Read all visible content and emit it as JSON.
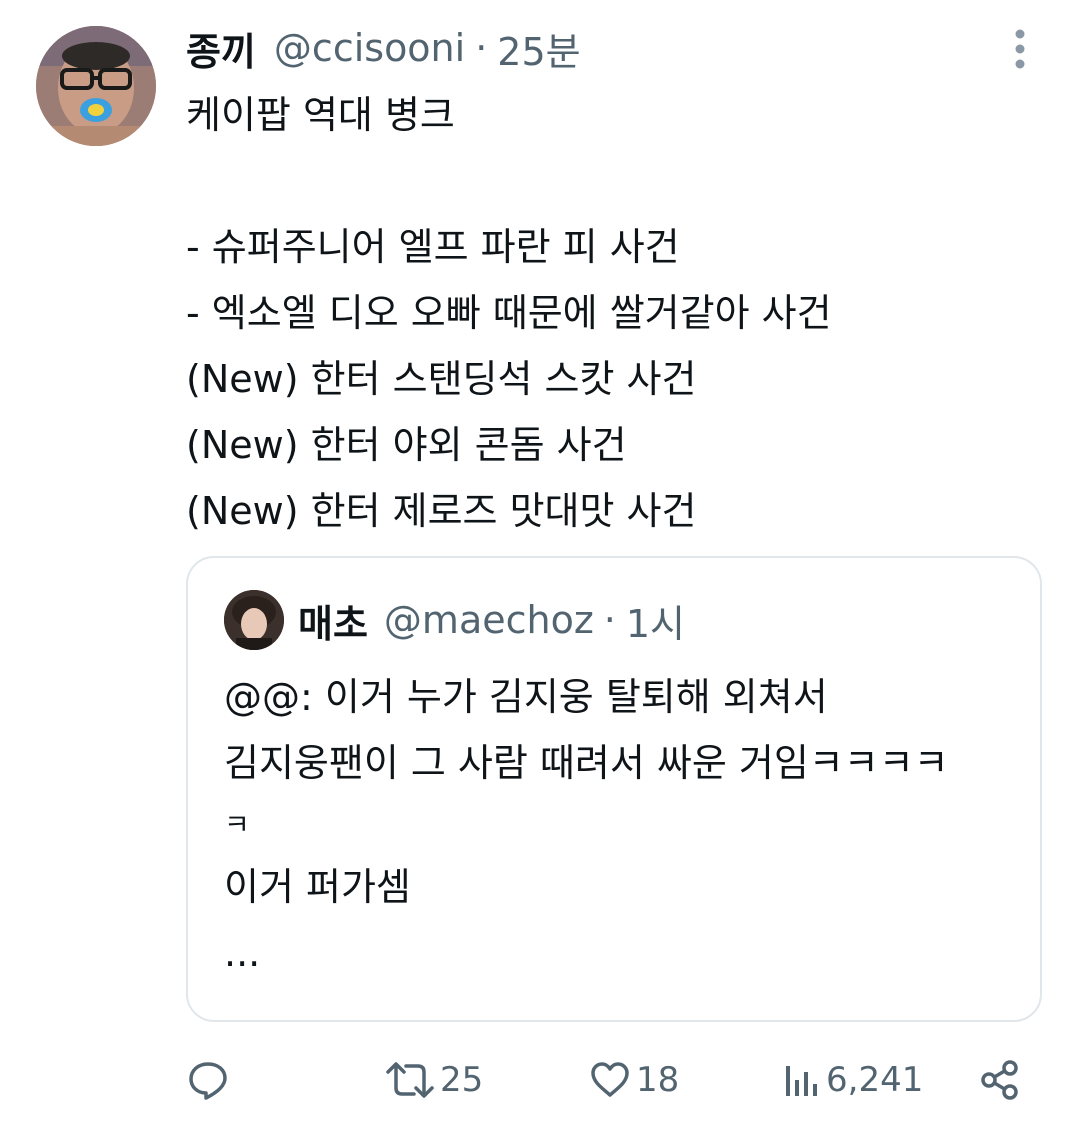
{
  "tweet": {
    "author_name": "종끼",
    "author_handle": "@ccisooni",
    "separator": "·",
    "time": "25분",
    "lines": [
      "케이팝 역대 병크",
      "",
      "- 슈퍼주니어 엘프 파란 피 사건",
      "- 엑소엘 디오 오빠 때문에 쌀거같아 사건",
      "(New) 한터 스탠딩석 스캇 사건",
      "(New) 한터 야외 콘돔 사건",
      "(New) 한터 제로즈 맛대맛 사건"
    ]
  },
  "quote": {
    "author_name": "매초",
    "author_handle": "@maechoz",
    "separator": "·",
    "time": "1시",
    "lines": [
      "@@: 이거 누가 김지웅 탈퇴해 외쳐서",
      "김지웅팬이 그 사람 때려서 싸운 거임ㅋㅋㅋㅋ",
      "ㅋ",
      "이거 퍼가셈",
      "..."
    ]
  },
  "actions": {
    "reply": {
      "icon": "reply-icon",
      "count": ""
    },
    "retweet": {
      "icon": "retweet-icon",
      "count": "25"
    },
    "like": {
      "icon": "heart-icon",
      "count": "18"
    },
    "views": {
      "icon": "views-icon",
      "count": "6,241"
    },
    "share": {
      "icon": "share-icon"
    }
  },
  "colors": {
    "text": "#0f1419",
    "secondary": "#536471",
    "border": "#e1e6ea"
  }
}
